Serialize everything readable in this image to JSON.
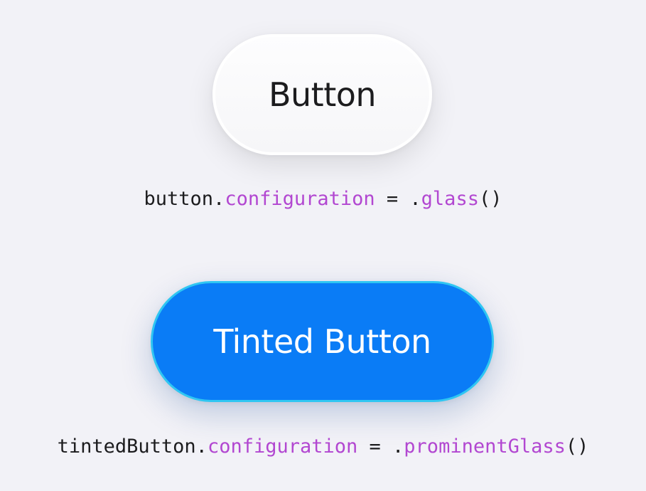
{
  "glass_button": {
    "label": "Button"
  },
  "glass_code": {
    "receiver": "button.",
    "property": "configuration",
    "operator": " = .",
    "method": "glass",
    "parens": "()"
  },
  "tinted_button": {
    "label": "Tinted Button"
  },
  "tinted_code": {
    "receiver": "tintedButton.",
    "property": "configuration",
    "operator": " = .",
    "method": "prominentGlass",
    "parens": "()"
  },
  "colors": {
    "background": "#f2f2f7",
    "glass_button_fill": "#f9f9fb",
    "tinted_button_fill": "#0a7cf6",
    "tinted_button_border": "#2fc6f2",
    "code_keyword": "#b247d1",
    "code_text": "#1c1c1e"
  }
}
